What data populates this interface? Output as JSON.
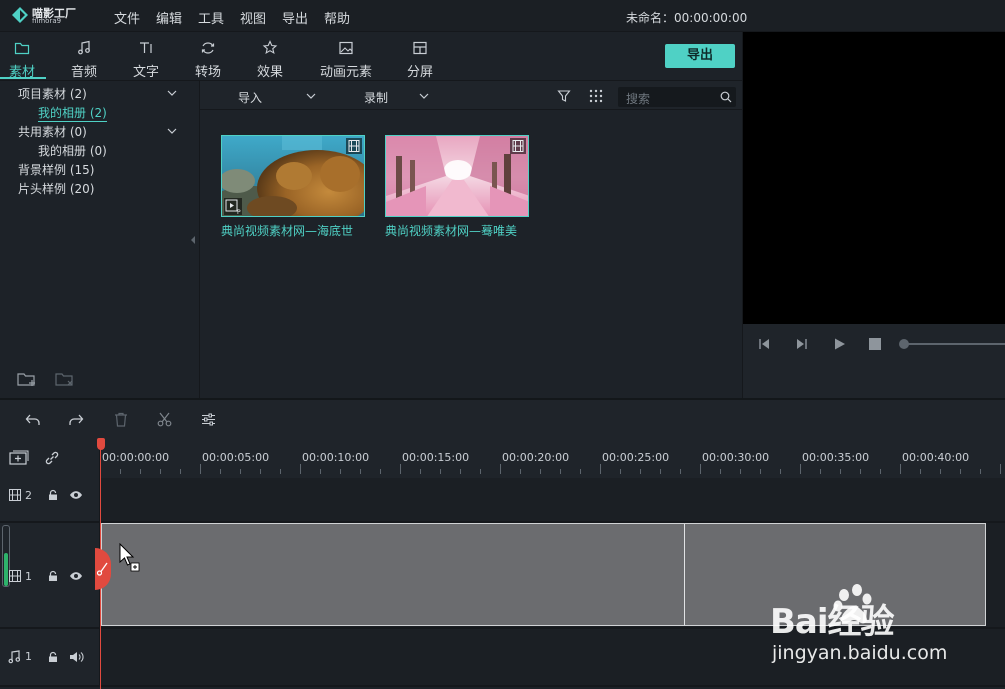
{
  "app": {
    "logo_cn": "喵影工厂",
    "logo_en": "filmora9",
    "title": "未命名：00:00:00:00",
    "accent": "#4fd1c5",
    "playhead_color": "#e14a3f"
  },
  "menu": [
    "文件",
    "编辑",
    "工具",
    "视图",
    "导出",
    "帮助"
  ],
  "tabs": [
    {
      "label": "素材",
      "icon": "folder-icon",
      "active": true
    },
    {
      "label": "音频",
      "icon": "music-note-icon"
    },
    {
      "label": "文字",
      "icon": "text-icon"
    },
    {
      "label": "转场",
      "icon": "transition-icon"
    },
    {
      "label": "效果",
      "icon": "effects-icon"
    },
    {
      "label": "动画元素",
      "icon": "image-icon"
    },
    {
      "label": "分屏",
      "icon": "split-screen-icon"
    }
  ],
  "export_label": "导出",
  "library": {
    "items": [
      {
        "label": "项目素材 (2)"
      },
      {
        "label": "我的相册 (2)"
      },
      {
        "label": "共用素材 (0)"
      },
      {
        "label": "我的相册 (0)"
      },
      {
        "label": "背景样例 (15)"
      },
      {
        "label": "片头样例 (20)"
      }
    ]
  },
  "media_toolbar": {
    "import_label": "导入",
    "record_label": "录制",
    "search_placeholder": "搜索"
  },
  "media": [
    {
      "caption": "典尚视频素材网—海底世"
    },
    {
      "caption": "典尚视频素材网—蓦唯美"
    }
  ],
  "timeline": {
    "timecodes": [
      "00:00:00:00",
      "00:00:05:00",
      "00:00:10:00",
      "00:00:15:00",
      "00:00:20:00",
      "00:00:25:00",
      "00:00:30:00",
      "00:00:35:00",
      "00:00:40:00"
    ],
    "tracks": [
      {
        "num": "2",
        "type": "video"
      },
      {
        "num": "1",
        "type": "video"
      },
      {
        "num": "1",
        "type": "audio"
      }
    ]
  },
  "watermark": {
    "brand": "Bai经验",
    "url": "jingyan.baidu.com"
  }
}
